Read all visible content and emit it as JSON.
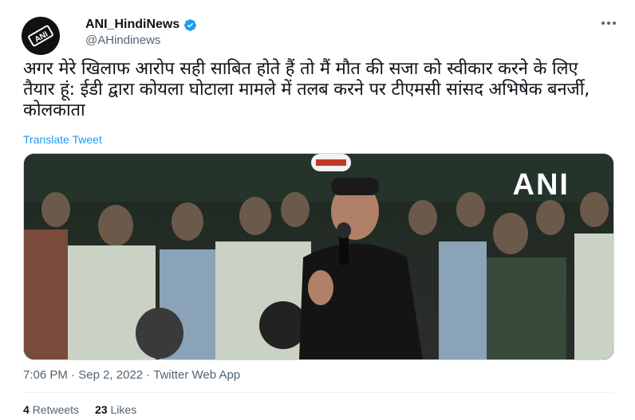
{
  "tweet": {
    "display_name": "ANI_HindiNews",
    "handle": "@AHindinews",
    "avatar_text": "ANI",
    "text": "अगर मेरे खिलाफ आरोप सही साबित होते हैं तो मैं मौत की सजा को स्वीकार करने के लिए तैयार हूं: ईडी द्वारा कोयला घोटाला मामले में तलब करने पर टीएमसी सांसद अभिषेक बनर्जी, कोलकाता",
    "translate_label": "Translate Tweet",
    "media_watermark": "ANI",
    "time": "7:06 PM",
    "date": "Sep 2, 2022",
    "source": "Twitter Web App",
    "meta_sep": "·",
    "retweets_count": "4",
    "retweets_label": "Retweets",
    "likes_count": "23",
    "likes_label": "Likes"
  },
  "colors": {
    "accent": "#1d9bf0",
    "text": "#0f1419",
    "muted": "#536471"
  },
  "icons": {
    "verified": "verified-badge-icon",
    "more": "more-options-icon"
  }
}
